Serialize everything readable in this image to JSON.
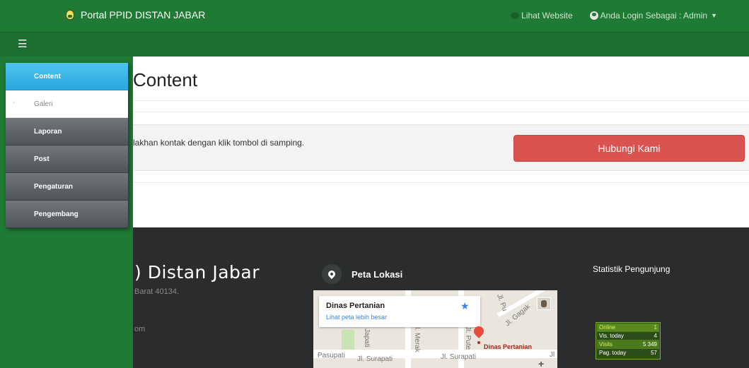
{
  "header": {
    "brand": "Portal PPID DISTAN JABAR",
    "links": [
      {
        "label": "Lihat Website",
        "icon": "globe-icon"
      },
      {
        "label": "Anda Login Sebagai : Admin",
        "icon": "user-icon"
      }
    ],
    "menu_icon": "hamburger-icon"
  },
  "sidebar": {
    "items": [
      {
        "label": "Content",
        "state": "active"
      },
      {
        "label": "Galeri",
        "state": "sub"
      },
      {
        "label": "Laporan"
      },
      {
        "label": "Post"
      },
      {
        "label": "Pengaturan"
      },
      {
        "label": "Pengembang"
      }
    ]
  },
  "main": {
    "title": "Content",
    "contact_text": "lakhan kontak dengan klik tombol di samping.",
    "contact_button": "Hubungi Kami"
  },
  "footer": {
    "title": ") Distan Jabar",
    "address": "Barat 40134.",
    "email": "om",
    "map": {
      "heading": "Peta Lokasi",
      "place_name": "Dinas Pertanian",
      "view_larger": "Lihat peta lebih besar",
      "marker_label": "Dinas Pertanian",
      "streets": [
        "Jl. Surapati",
        "Jl. Surapati",
        "Pasupati",
        "Jl. Gagak",
        "Jl. Merak",
        "Jl. Pute",
        "Jl. Pu",
        "Japati",
        "Jl"
      ]
    },
    "stats": {
      "heading": "Statistik Pengunjung",
      "rows": [
        {
          "label": "Online",
          "value": "1"
        },
        {
          "label": "Vis. today",
          "value": "4"
        },
        {
          "label": "Visits",
          "value": "5 349"
        },
        {
          "label": "Pag. today",
          "value": "57"
        }
      ]
    }
  },
  "colors": {
    "header_green": "#1f7a33",
    "active_blue": "#2aa8de",
    "button_red": "#d9534f",
    "footer_dark": "#2a2c2d"
  }
}
